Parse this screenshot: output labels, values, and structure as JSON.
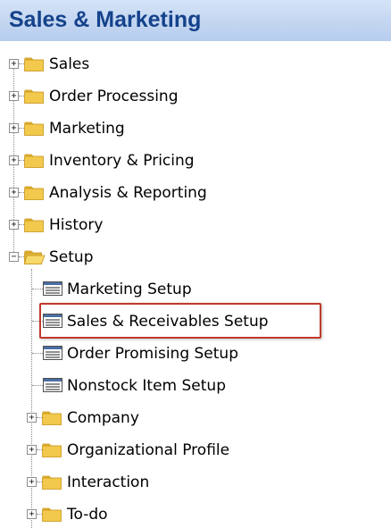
{
  "header": {
    "title": "Sales & Marketing"
  },
  "tree": {
    "top_nodes": [
      {
        "label": "Sales",
        "expander": "+",
        "icon": "folder-closed-icon"
      },
      {
        "label": "Order Processing",
        "expander": "+",
        "icon": "folder-closed-icon"
      },
      {
        "label": "Marketing",
        "expander": "+",
        "icon": "folder-closed-icon"
      },
      {
        "label": "Inventory & Pricing",
        "expander": "+",
        "icon": "folder-closed-icon"
      },
      {
        "label": "Analysis & Reporting",
        "expander": "+",
        "icon": "folder-closed-icon"
      },
      {
        "label": "History",
        "expander": "+",
        "icon": "folder-closed-icon"
      },
      {
        "label": "Setup",
        "expander": "−",
        "icon": "folder-open-icon"
      }
    ],
    "setup_items": [
      {
        "label": "Marketing Setup",
        "icon": "form-icon"
      },
      {
        "label": "Sales & Receivables Setup",
        "icon": "form-icon",
        "highlighted": true
      },
      {
        "label": "Order Promising Setup",
        "icon": "form-icon"
      },
      {
        "label": "Nonstock Item Setup",
        "icon": "form-icon"
      }
    ],
    "setup_folders": [
      {
        "label": "Company",
        "expander": "+",
        "icon": "folder-closed-icon"
      },
      {
        "label": "Organizational Profile",
        "expander": "+",
        "icon": "folder-closed-icon"
      },
      {
        "label": "Interaction",
        "expander": "+",
        "icon": "folder-closed-icon"
      },
      {
        "label": "To-do",
        "expander": "+",
        "icon": "folder-closed-icon"
      }
    ]
  },
  "colors": {
    "header_text": "#15428b",
    "header_background": "#c3d6f1",
    "folder": "#f2c94c",
    "highlight_border": "#c0392b"
  }
}
